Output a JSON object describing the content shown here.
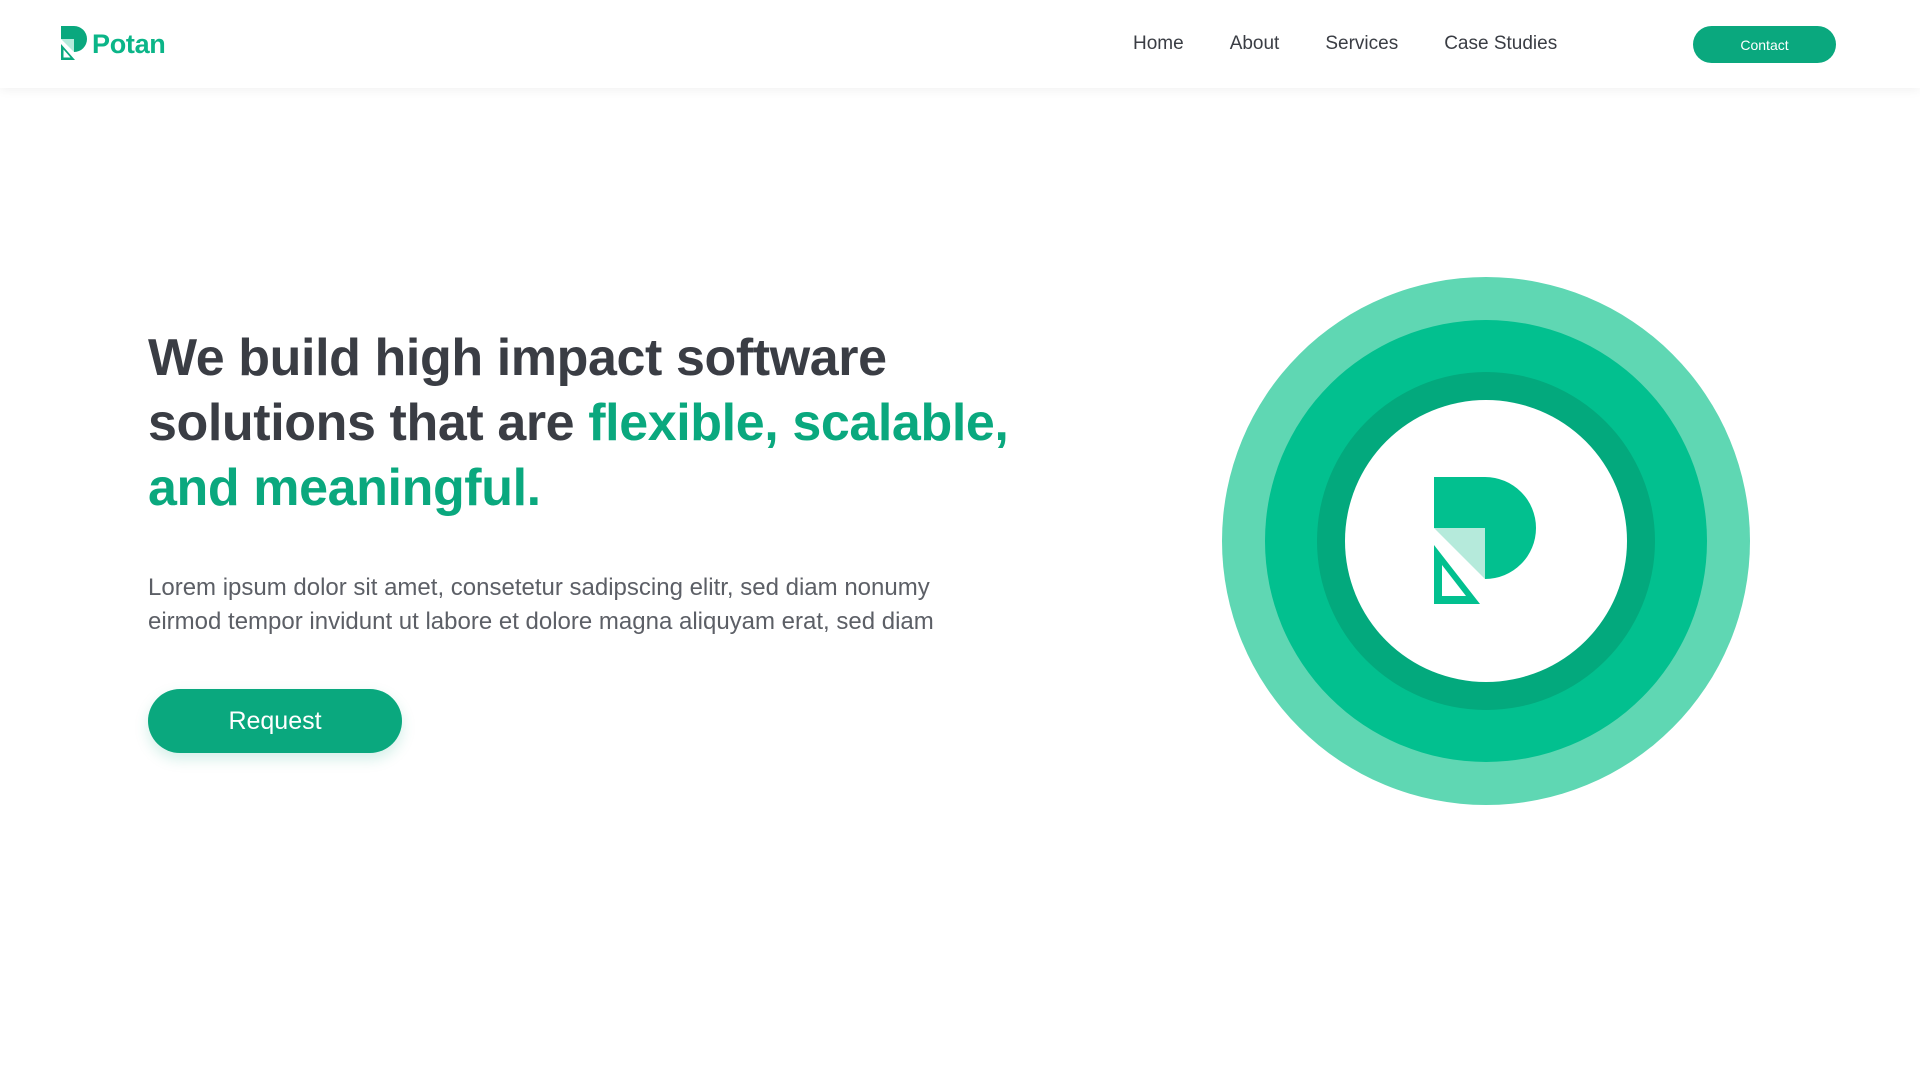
{
  "brand": {
    "name": "Potan",
    "logo_icon": "potan-logo-icon",
    "primary_color": "#0aa87e",
    "accent_color": "#02c08f",
    "light_color": "#5fd7b3"
  },
  "nav": {
    "items": [
      {
        "label": "Home"
      },
      {
        "label": "About"
      },
      {
        "label": "Services"
      },
      {
        "label": "Case Studies"
      }
    ],
    "contact_label": "Contact"
  },
  "hero": {
    "title_part1": "We build high impact software solutions that are ",
    "title_accent": "flexible, scalable, and meaningful.",
    "description": "Lorem ipsum dolor sit amet, consetetur sadipscing elitr, sed diam nonumy eirmod tempor invidunt ut labore et dolore magna aliquyam erat, sed diam",
    "button_label": "Request"
  },
  "illustration": {
    "icon": "potan-emblem-icon"
  }
}
